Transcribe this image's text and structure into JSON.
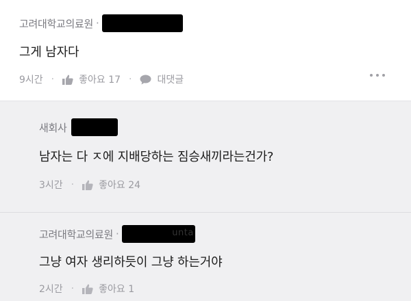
{
  "comments": [
    {
      "author": "고려대학교의료원",
      "text": "그게 남자다",
      "time": "9시간",
      "like_label": "좋아요 17",
      "reply_label": "대댓글"
    },
    {
      "author": "새회사",
      "text": "남자는 다 ㅈ에 지배당하는 짐승새끼라는건가?",
      "time": "3시간",
      "like_label": "좋아요 24"
    },
    {
      "author": "고려대학교의료원",
      "redaction_fragment": "unta",
      "text": "그냥 여자 생리하듯이 그냥 하는거야",
      "time": "2시간",
      "like_label": "좋아요 1"
    }
  ],
  "icons": {
    "like": "thumbs-up-icon",
    "reply": "speech-bubble-icon",
    "more": "more-horizontal-icon"
  }
}
